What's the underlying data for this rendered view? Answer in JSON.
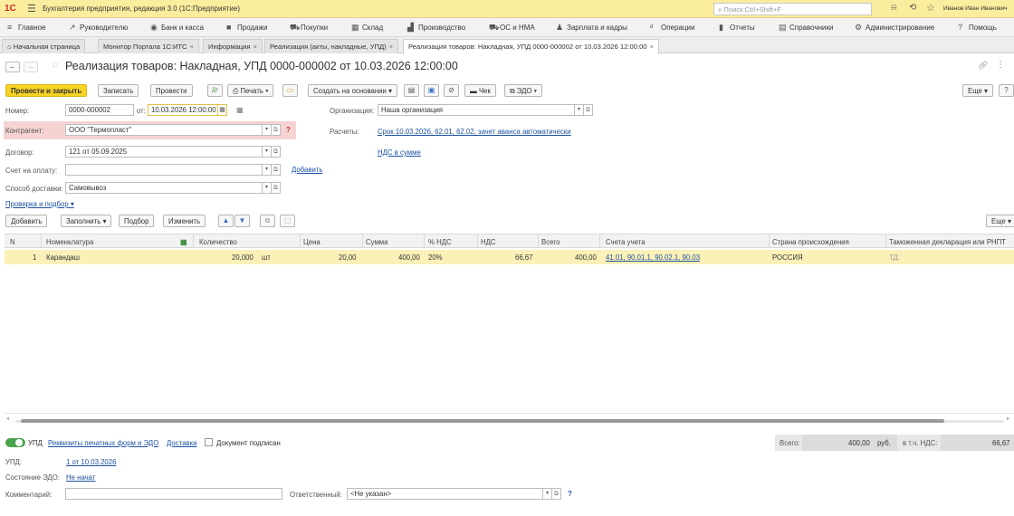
{
  "titlebar": {
    "logo": "1С",
    "app_title": "Бухгалтерия предприятия, редакция 3.0  (1С:Предприятие)",
    "search_placeholder": "Поиск Ctrl+Shift+F",
    "user": "Иванов Иван Иванович"
  },
  "menu": {
    "items": [
      "Главное",
      "Руководителю",
      "Банк и касса",
      "Продажи",
      "Покупки",
      "Склад",
      "Производство",
      "ОС и НМА",
      "Зарплата и кадры",
      "Операции",
      "Отчеты",
      "Справочники",
      "Администрирование",
      "Помощь"
    ]
  },
  "tabs": [
    {
      "label": "Начальная страница"
    },
    {
      "label": "Монитор Портала 1С:ИТС"
    },
    {
      "label": "Информация"
    },
    {
      "label": "Реализация (акты, накладные, УПД)"
    },
    {
      "label": "Реализация товаров: Накладная, УПД 0000-000002 от 10.03.2026 12:00:00"
    }
  ],
  "document": {
    "title": "Реализация товаров: Накладная, УПД 0000-000002 от 10.03.2026 12:00:00"
  },
  "toolbar": {
    "post_close": "Провести и закрыть",
    "save": "Записать",
    "post": "Провести",
    "print": "Печать",
    "create_based": "Создать на основании",
    "check": "Чек",
    "edo": "ЭДО",
    "more": "Еще",
    "help": "?"
  },
  "form": {
    "number_label": "Номер:",
    "number": "0000-000002",
    "date_label": "от:",
    "date": "10.03.2026 12:00:00",
    "counterparty_label": "Контрагент:",
    "counterparty": "ООО \"Термопласт\"",
    "contract_label": "Договор:",
    "contract": "121 от 05.09.2025",
    "invoice_label": "Счет на оплату:",
    "invoice": "",
    "add_link": "Добавить",
    "delivery_label": "Способ доставки:",
    "delivery": "Самовывоз",
    "org_label": "Организация:",
    "org": "Наша организация",
    "settlements_label": "Расчеты:",
    "settlements_link": "Срок 10.03.2026, 62.01, 62.02, зачет аванса автоматически",
    "vat_link": "НДС в сумме",
    "check_select": "Проверка и подбор"
  },
  "table_toolbar": {
    "add": "Добавить",
    "fill": "Заполнить",
    "select": "Подбор",
    "change": "Изменить",
    "more": "Еще"
  },
  "table": {
    "columns": [
      "N",
      "Номенклатура",
      "Количество",
      "Цена",
      "Сумма",
      "% НДС",
      "НДС",
      "Всего",
      "Счета учета",
      "Страна происхождения",
      "Таможенная декларация или РНПТ"
    ],
    "rows": [
      {
        "n": "1",
        "item": "Карандаш",
        "qty": "20,000",
        "unit": "шт",
        "price": "20,00",
        "sum": "400,00",
        "vat_rate": "20%",
        "vat": "66,67",
        "total": "400,00",
        "accounts": "41.01, 90.01.1, 90.02.1, 90.03",
        "country": "РОССИЯ",
        "customs": "ТД:"
      }
    ]
  },
  "footer": {
    "upd_label": "УПД",
    "print_forms_link": "Реквизиты печатных форм и ЭДО",
    "delivery_link": "Доставка",
    "signed_label": "Документ подписан",
    "totals_label": "Всего:",
    "totals_value": "400,00",
    "currency": "руб.",
    "vat_label": "в т.ч. НДС:",
    "vat_value": "66,67",
    "upd_field_label": "УПД:",
    "upd_link": "1 от 10.03.2026",
    "edo_state_label": "Состояние ЭДО:",
    "edo_state_link": "Не начат",
    "comment_label": "Комментарий:",
    "comment": "",
    "responsible_label": "Ответственный:",
    "responsible": "<Не указан>"
  }
}
